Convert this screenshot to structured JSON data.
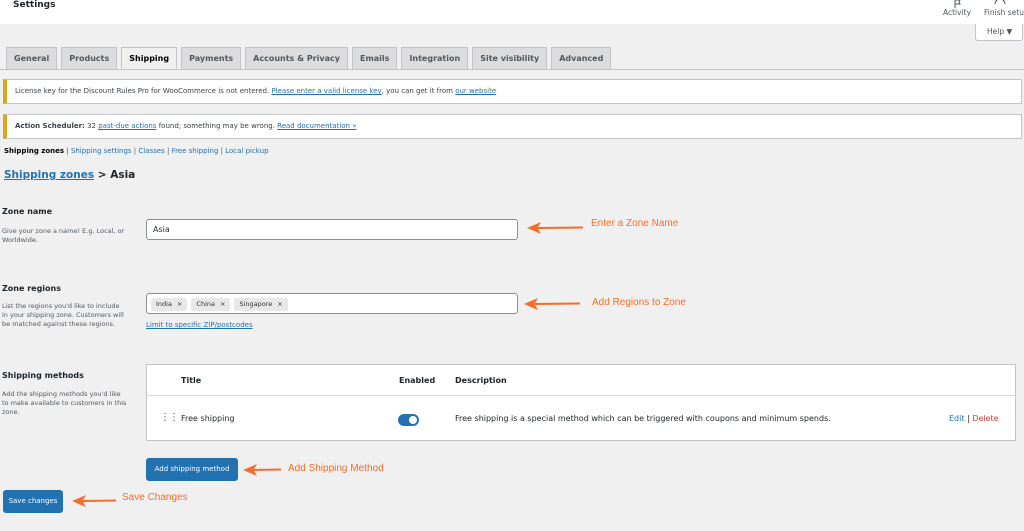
{
  "topbar": {
    "title": "Settings",
    "activity_label": "Activity",
    "finish_setup_label": "Finish setu"
  },
  "help_label": "Help ▼",
  "tabs": [
    {
      "label": "General"
    },
    {
      "label": "Products"
    },
    {
      "label": "Shipping"
    },
    {
      "label": "Payments"
    },
    {
      "label": "Accounts & Privacy"
    },
    {
      "label": "Emails"
    },
    {
      "label": "Integration"
    },
    {
      "label": "Site visibility"
    },
    {
      "label": "Advanced"
    }
  ],
  "notice_license": {
    "text": "License key for the Discount Rules Pro for WooCommerce is not entered. ",
    "link1": "Please enter a valid license key",
    "middle": ", you can get it from ",
    "link2": "our website"
  },
  "notice_scheduler": {
    "bold": "Action Scheduler:",
    "count_text": " 32 ",
    "link1": "past-due actions",
    "middle": " found; something may be wrong. ",
    "link2": "Read documentation »"
  },
  "subnav": {
    "current": "Shipping zones",
    "items": [
      "Shipping settings",
      "Classes",
      "Free shipping",
      "Local pickup"
    ],
    "sep": " | "
  },
  "breadcrumb": {
    "link": "Shipping zones",
    "rest": " > Asia"
  },
  "zone_name": {
    "label": "Zone name",
    "description": "Give your zone a name! E.g. Local, or Worldwide.",
    "value": "Asia"
  },
  "zone_regions": {
    "label": "Zone regions",
    "description": "List the regions you'd like to include in your shipping zone. Customers will be matched against these regions.",
    "chips": [
      "India",
      "China",
      "Singapore"
    ],
    "remove": "×",
    "limit_link": "Limit to specific ZIP/postcodes"
  },
  "shipping_methods": {
    "label": "Shipping methods",
    "description": "Add the shipping methods you'd like to make available to customers in this zone.",
    "headers": {
      "title": "Title",
      "enabled": "Enabled",
      "description": "Description"
    },
    "rows": [
      {
        "title": "Free shipping",
        "enabled": true,
        "description": "Free shipping is a special method which can be triggered with coupons and minimum spends.",
        "edit": "Edit",
        "sep": " | ",
        "delete": "Delete"
      }
    ],
    "drag_handle": "⋮⋮"
  },
  "buttons": {
    "add_method": "Add shipping method",
    "save": "Save changes"
  },
  "annotations": {
    "zone_name": "Enter a Zone Name",
    "regions": "Add Regions to Zone",
    "add_method": "Add Shipping Method",
    "save": "Save Changes",
    "color": "#f56e28"
  }
}
